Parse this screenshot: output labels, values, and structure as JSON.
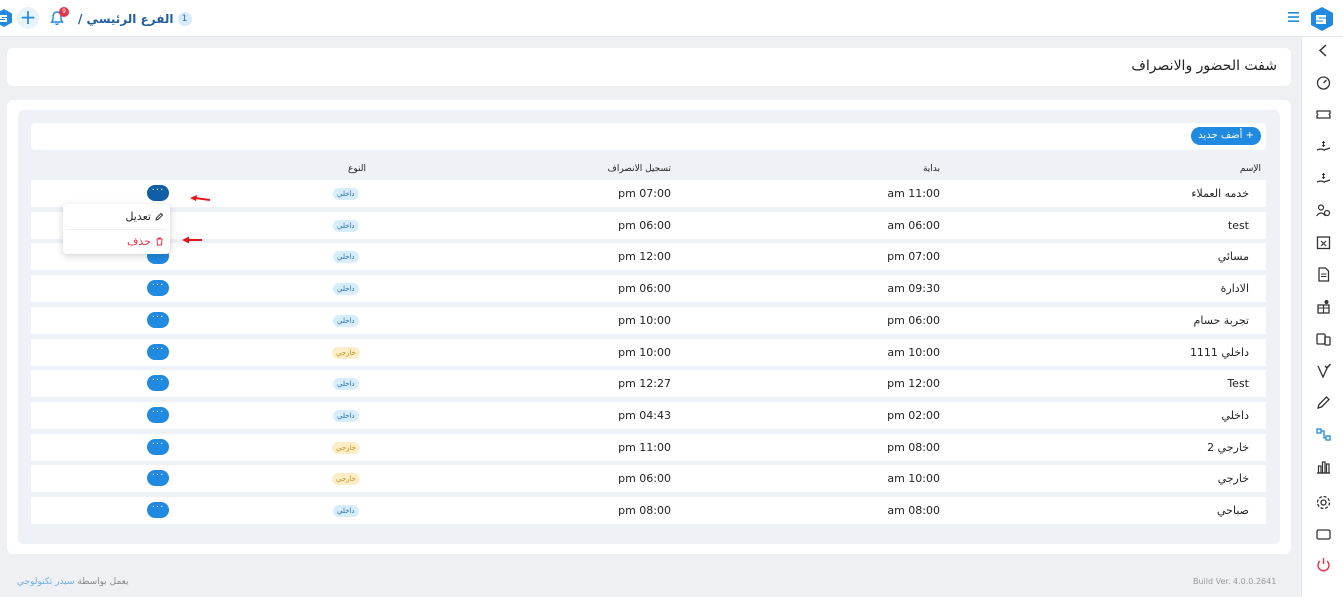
{
  "header": {
    "branch_number": "1",
    "branch_label": "الفرع الرئيسي /",
    "notification_count": "9"
  },
  "page": {
    "title": "شفت الحضور والانصراف",
    "add_button": "+ أضف جديد"
  },
  "table": {
    "columns": {
      "name": "الإسم",
      "start": "بداية",
      "checkout": "تسجيل الانصراف",
      "type": "النوع"
    },
    "rows": [
      {
        "name": "خدمه العملاء",
        "start": "am 11:00",
        "end": "pm 07:00",
        "type": "داخلي",
        "type_kind": "internal"
      },
      {
        "name": "test",
        "start": "am 06:00",
        "end": "pm 06:00",
        "type": "داخلي",
        "type_kind": "internal"
      },
      {
        "name": "مسائي",
        "start": "pm 07:00",
        "end": "pm 12:00",
        "type": "داخلي",
        "type_kind": "internal"
      },
      {
        "name": "الادارة",
        "start": "am 09:30",
        "end": "pm 06:00",
        "type": "داخلي",
        "type_kind": "internal"
      },
      {
        "name": "تجربة حسام",
        "start": "pm 06:00",
        "end": "pm 10:00",
        "type": "داخلي",
        "type_kind": "internal"
      },
      {
        "name": "داخلي 1111",
        "start": "am 10:00",
        "end": "pm 10:00",
        "type": "خارجي",
        "type_kind": "external"
      },
      {
        "name": "Test",
        "start": "pm 12:00",
        "end": "pm 12:27",
        "type": "داخلي",
        "type_kind": "internal"
      },
      {
        "name": "داخلي",
        "start": "pm 02:00",
        "end": "pm 04:43",
        "type": "داخلي",
        "type_kind": "internal"
      },
      {
        "name": "خارجي 2",
        "start": "pm 08:00",
        "end": "pm 11:00",
        "type": "خارجي",
        "type_kind": "external"
      },
      {
        "name": "خارجي",
        "start": "am 10:00",
        "end": "pm 06:00",
        "type": "خارجي",
        "type_kind": "external"
      },
      {
        "name": "صباحي",
        "start": "am 08:00",
        "end": "pm 08:00",
        "type": "داخلي",
        "type_kind": "internal"
      }
    ],
    "actions_label": "···"
  },
  "dropdown": {
    "edit": "تعديل",
    "delete": "حذف"
  },
  "footer": {
    "powered_by": "يعمل بواسطة",
    "company": "سيدر تكنولوجي",
    "build": "Build Ver. 4.0.0.2641"
  },
  "colors": {
    "primary": "#1f8ae0",
    "danger": "#e5344b",
    "internal_badge": "#d8edfb",
    "external_badge": "#fdeec8"
  },
  "sidebar_icons": [
    "chevron-left-icon",
    "dashboard-gauge-icon",
    "ticket-icon",
    "hand-money-icon",
    "hand-money-2-icon",
    "users-icon",
    "calendar-x-icon",
    "document-icon",
    "gift-icon",
    "devices-icon",
    "shield-check-icon",
    "pen-icon",
    "workflow-icon",
    "bar-chart-icon",
    "settings-icon",
    "screen-icon",
    "power-icon"
  ]
}
